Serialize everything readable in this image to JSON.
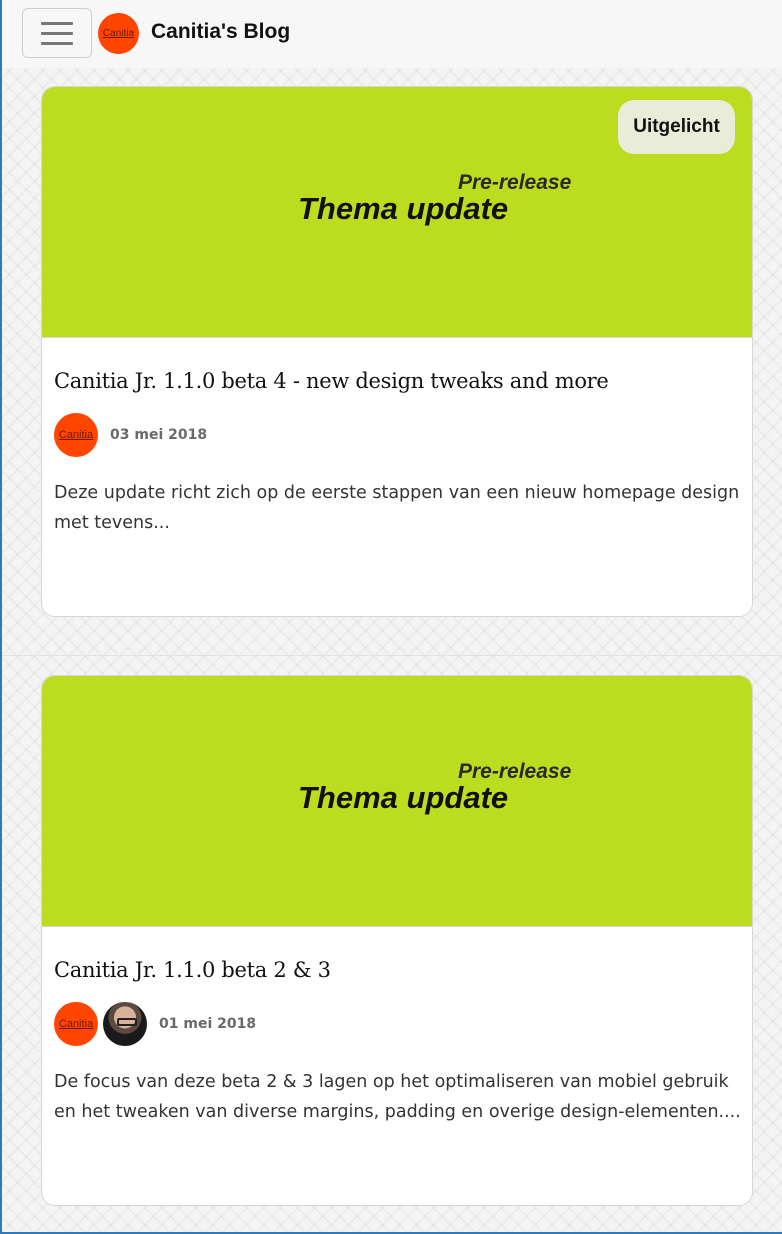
{
  "header": {
    "logo_text": "Canitia",
    "brand": "Canitia's Blog",
    "menu_icon": "hamburger-icon"
  },
  "posts": [
    {
      "banner_subtitle": "Pre-release",
      "banner_title": "Thema update",
      "badge": "Uitgelicht",
      "title": "Canitia Jr. 1.1.0 beta 4 - new design tweaks and more",
      "author_avatar_text": "Canitia",
      "date": "03 mei 2018",
      "excerpt": "Deze update richt zich op de eerste stappen van een nieuw homepage design met tevens..."
    },
    {
      "banner_subtitle": "Pre-release",
      "banner_title": "Thema update",
      "title": "Canitia Jr. 1.1.0 beta 2 & 3",
      "author_avatar_text": "Canitia",
      "date": "01 mei 2018",
      "excerpt": "De focus van deze beta 2 & 3 lagen op het optimaliseren van mobiel gebruik en het tweaken van diverse margins, padding en overige design-elementen...."
    }
  ],
  "colors": {
    "accent": "#ff4500",
    "banner": "#bcdc1f",
    "badge_bg": "#e8ecd9"
  }
}
